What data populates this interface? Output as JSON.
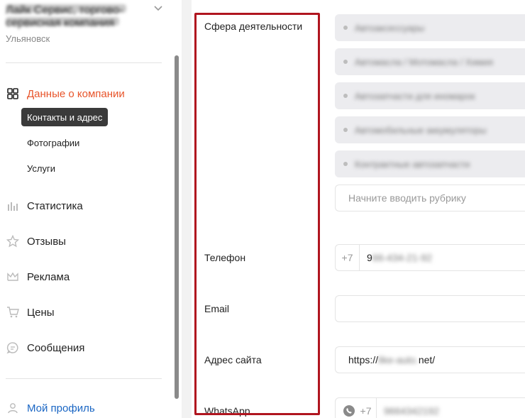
{
  "sidebar": {
    "company_name_lines": [
      "Лайк Сервис, торгово-",
      "сервисная компания"
    ],
    "city": "Ульяновск",
    "nav": {
      "company_data": "Данные о компании",
      "contacts": "Контакты и адрес",
      "photos": "Фотографии",
      "services": "Услуги",
      "statistics": "Статистика",
      "reviews": "Отзывы",
      "ads": "Реклама",
      "prices": "Цены",
      "messages": "Сообщения",
      "profile": "Мой профиль"
    },
    "icons": {
      "company_data": "grid-icon",
      "statistics": "bar-chart-icon",
      "reviews": "star-icon",
      "ads": "crown-icon",
      "prices": "cart-icon",
      "messages": "chat-icon",
      "profile": "user-icon"
    }
  },
  "form": {
    "activity_label": "Сфера деятельности",
    "activity_chips": [
      "Автоаксессуары",
      "Автомасла / Мотомасла / Химия",
      "Автозапчасти для иномарок",
      "Автомобильные аккумуляторы",
      "Контрактные автозапчасти"
    ],
    "rubric_placeholder": "Начните вводить рубрику",
    "phone_label": "Телефон",
    "phone_prefix": "+7",
    "phone_value_visible": "9",
    "phone_value_hidden": "66-434-21-92",
    "email_label": "Email",
    "email_value": "",
    "website_label": "Адрес сайта",
    "website_value_start": "https://",
    "website_value_hidden": "like-auto.",
    "website_value_end": "net/",
    "whatsapp_label": "WhatsApp",
    "whatsapp_prefix": "+7",
    "whatsapp_value_hidden": "9664342192"
  },
  "colors": {
    "accent_orange": "#e8542a",
    "profile_blue": "#1a66c4",
    "highlight_frame": "#b0151f",
    "selected_item_bg": "#3a3a3a"
  }
}
